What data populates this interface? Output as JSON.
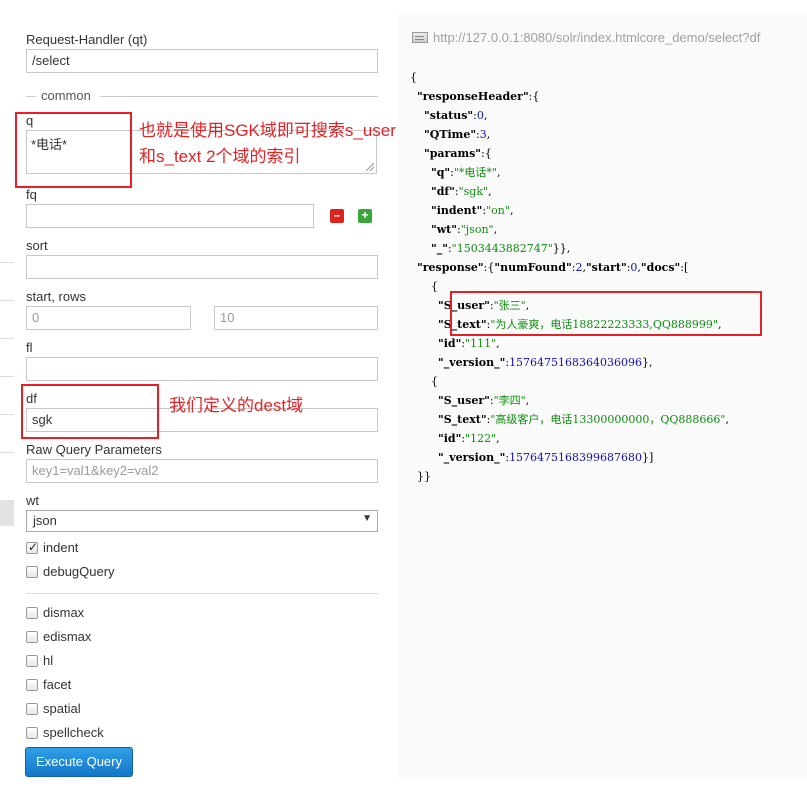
{
  "form": {
    "request_handler": {
      "label": "Request-Handler (qt)",
      "value": "/select"
    },
    "common_section": "common",
    "q": {
      "label": "q",
      "value": "*电话*"
    },
    "fq": {
      "label": "fq",
      "value": ""
    },
    "sort": {
      "label": "sort",
      "value": ""
    },
    "start_rows": {
      "label": "start, rows",
      "start": "0",
      "rows": "10"
    },
    "fl": {
      "label": "fl",
      "value": ""
    },
    "df": {
      "label": "df",
      "value": "sgk"
    },
    "raw_query": {
      "label": "Raw Query Parameters",
      "placeholder": "key1=val1&key2=val2"
    },
    "wt": {
      "label": "wt",
      "selected": "json"
    },
    "checkboxes": {
      "indent": {
        "label": "indent",
        "checked": true
      },
      "debug_query": {
        "label": "debugQuery",
        "checked": false
      },
      "dismax": {
        "label": "dismax",
        "checked": false
      },
      "edismax": {
        "label": "edismax",
        "checked": false
      },
      "hl": {
        "label": "hl",
        "checked": false
      },
      "facet": {
        "label": "facet",
        "checked": false
      },
      "spatial": {
        "label": "spatial",
        "checked": false
      },
      "spellcheck": {
        "label": "spellcheck",
        "checked": false
      }
    },
    "execute_label": "Execute Query"
  },
  "annotations": {
    "q_note_line1": "也就是使用SGK域即可搜索s_user",
    "q_note_line2": "和s_text 2个域的索引",
    "df_note": "我们定义的dest域",
    "color": "#e52125"
  },
  "response": {
    "url": "http://127.0.0.1:8080/solr/index.htmlcore_demo/select?df",
    "json_lines": {
      "l0": "{",
      "responseHeader_key": "\"responseHeader\"",
      "status_key": "\"status\"",
      "status_val": "0",
      "qtime_key": "\"QTime\"",
      "qtime_val": "3",
      "params_key": "\"params\"",
      "q_key": "\"q\"",
      "q_val": "\"*电话*\"",
      "df_key": "\"df\"",
      "df_val": "\"sgk\"",
      "indent_key": "\"indent\"",
      "indent_val": "\"on\"",
      "wt_key": "\"wt\"",
      "wt_val": "\"json\"",
      "underscore_key": "\"_\"",
      "underscore_val": "\"1503443882747\"",
      "response_key": "\"response\"",
      "numfound_key": "\"numFound\"",
      "numfound_val": "2",
      "start_key": "\"start\"",
      "start_val": "0",
      "docs_key": "\"docs\"",
      "doc1_user_key": "\"S_user\"",
      "doc1_user_val": "\"张三\"",
      "doc1_text_key": "\"S_text\"",
      "doc1_text_val": "\"为人豪爽，电话18822223333,QQ888999\"",
      "doc1_id_key": "\"id\"",
      "doc1_id_val": "\"111\"",
      "doc1_version_key": "\"_version_\"",
      "doc1_version_val": "1576475168364036096",
      "doc2_user_key": "\"S_user\"",
      "doc2_user_val": "\"李四\"",
      "doc2_text_key": "\"S_text\"",
      "doc2_text_val": "\"高级客户，电话13300000000，QQ888666\"",
      "doc2_id_key": "\"id\"",
      "doc2_id_val": "\"122\"",
      "doc2_version_key": "\"_version_\"",
      "doc2_version_val": "1576475168399687680"
    }
  }
}
